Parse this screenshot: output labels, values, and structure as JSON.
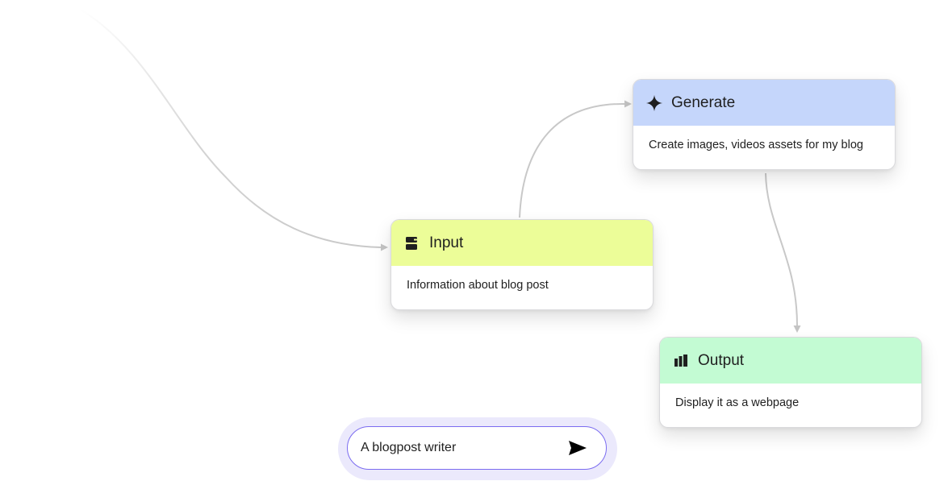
{
  "nodes": {
    "input": {
      "title": "Input",
      "description": "Information about blog post",
      "icon": "input-icon",
      "header_color": "#ecfd98"
    },
    "generate": {
      "title": "Generate",
      "description": "Create images, videos assets for my blog",
      "icon": "sparkle-icon",
      "header_color": "#c5d6fb"
    },
    "output": {
      "title": "Output",
      "description": "Display it as a webpage",
      "icon": "output-icon",
      "header_color": "#c3fbd3"
    }
  },
  "edges": [
    {
      "from": "offscreen",
      "to": "input"
    },
    {
      "from": "input",
      "to": "generate"
    },
    {
      "from": "generate",
      "to": "output"
    }
  ],
  "prompt": {
    "text": "A blogpost writer",
    "send_icon": "send-icon",
    "accent_color": "#7b6cf0"
  }
}
